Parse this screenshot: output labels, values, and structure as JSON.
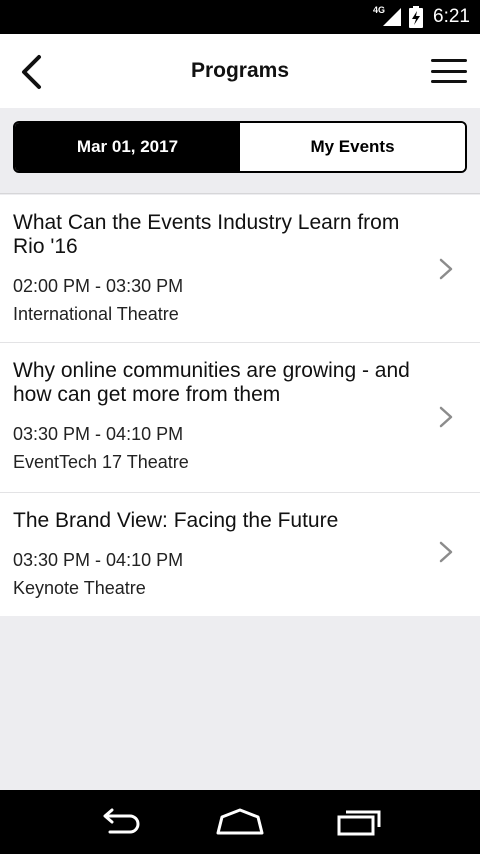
{
  "status_bar": {
    "network": "4G",
    "time": "6:21"
  },
  "header": {
    "title": "Programs",
    "back_icon": "chevron-left-icon",
    "menu_icon": "hamburger-menu-icon"
  },
  "tabs": [
    {
      "label": "Mar 01, 2017",
      "active": true
    },
    {
      "label": "My Events",
      "active": false
    }
  ],
  "events": [
    {
      "title": "What Can the Events Industry Learn from Rio '16",
      "time": "02:00 PM - 03:30 PM",
      "location": "International Theatre"
    },
    {
      "title": "Why online communities are growing - and how can get more from them",
      "time": "03:30 PM - 04:10 PM",
      "location": "EventTech 17 Theatre"
    },
    {
      "title": "The Brand View: Facing the Future",
      "time": "03:30 PM - 04:10 PM",
      "location": "Keynote Theatre"
    }
  ],
  "colors": {
    "accent": "#000000",
    "background": "#ededf0",
    "card": "#ffffff"
  }
}
